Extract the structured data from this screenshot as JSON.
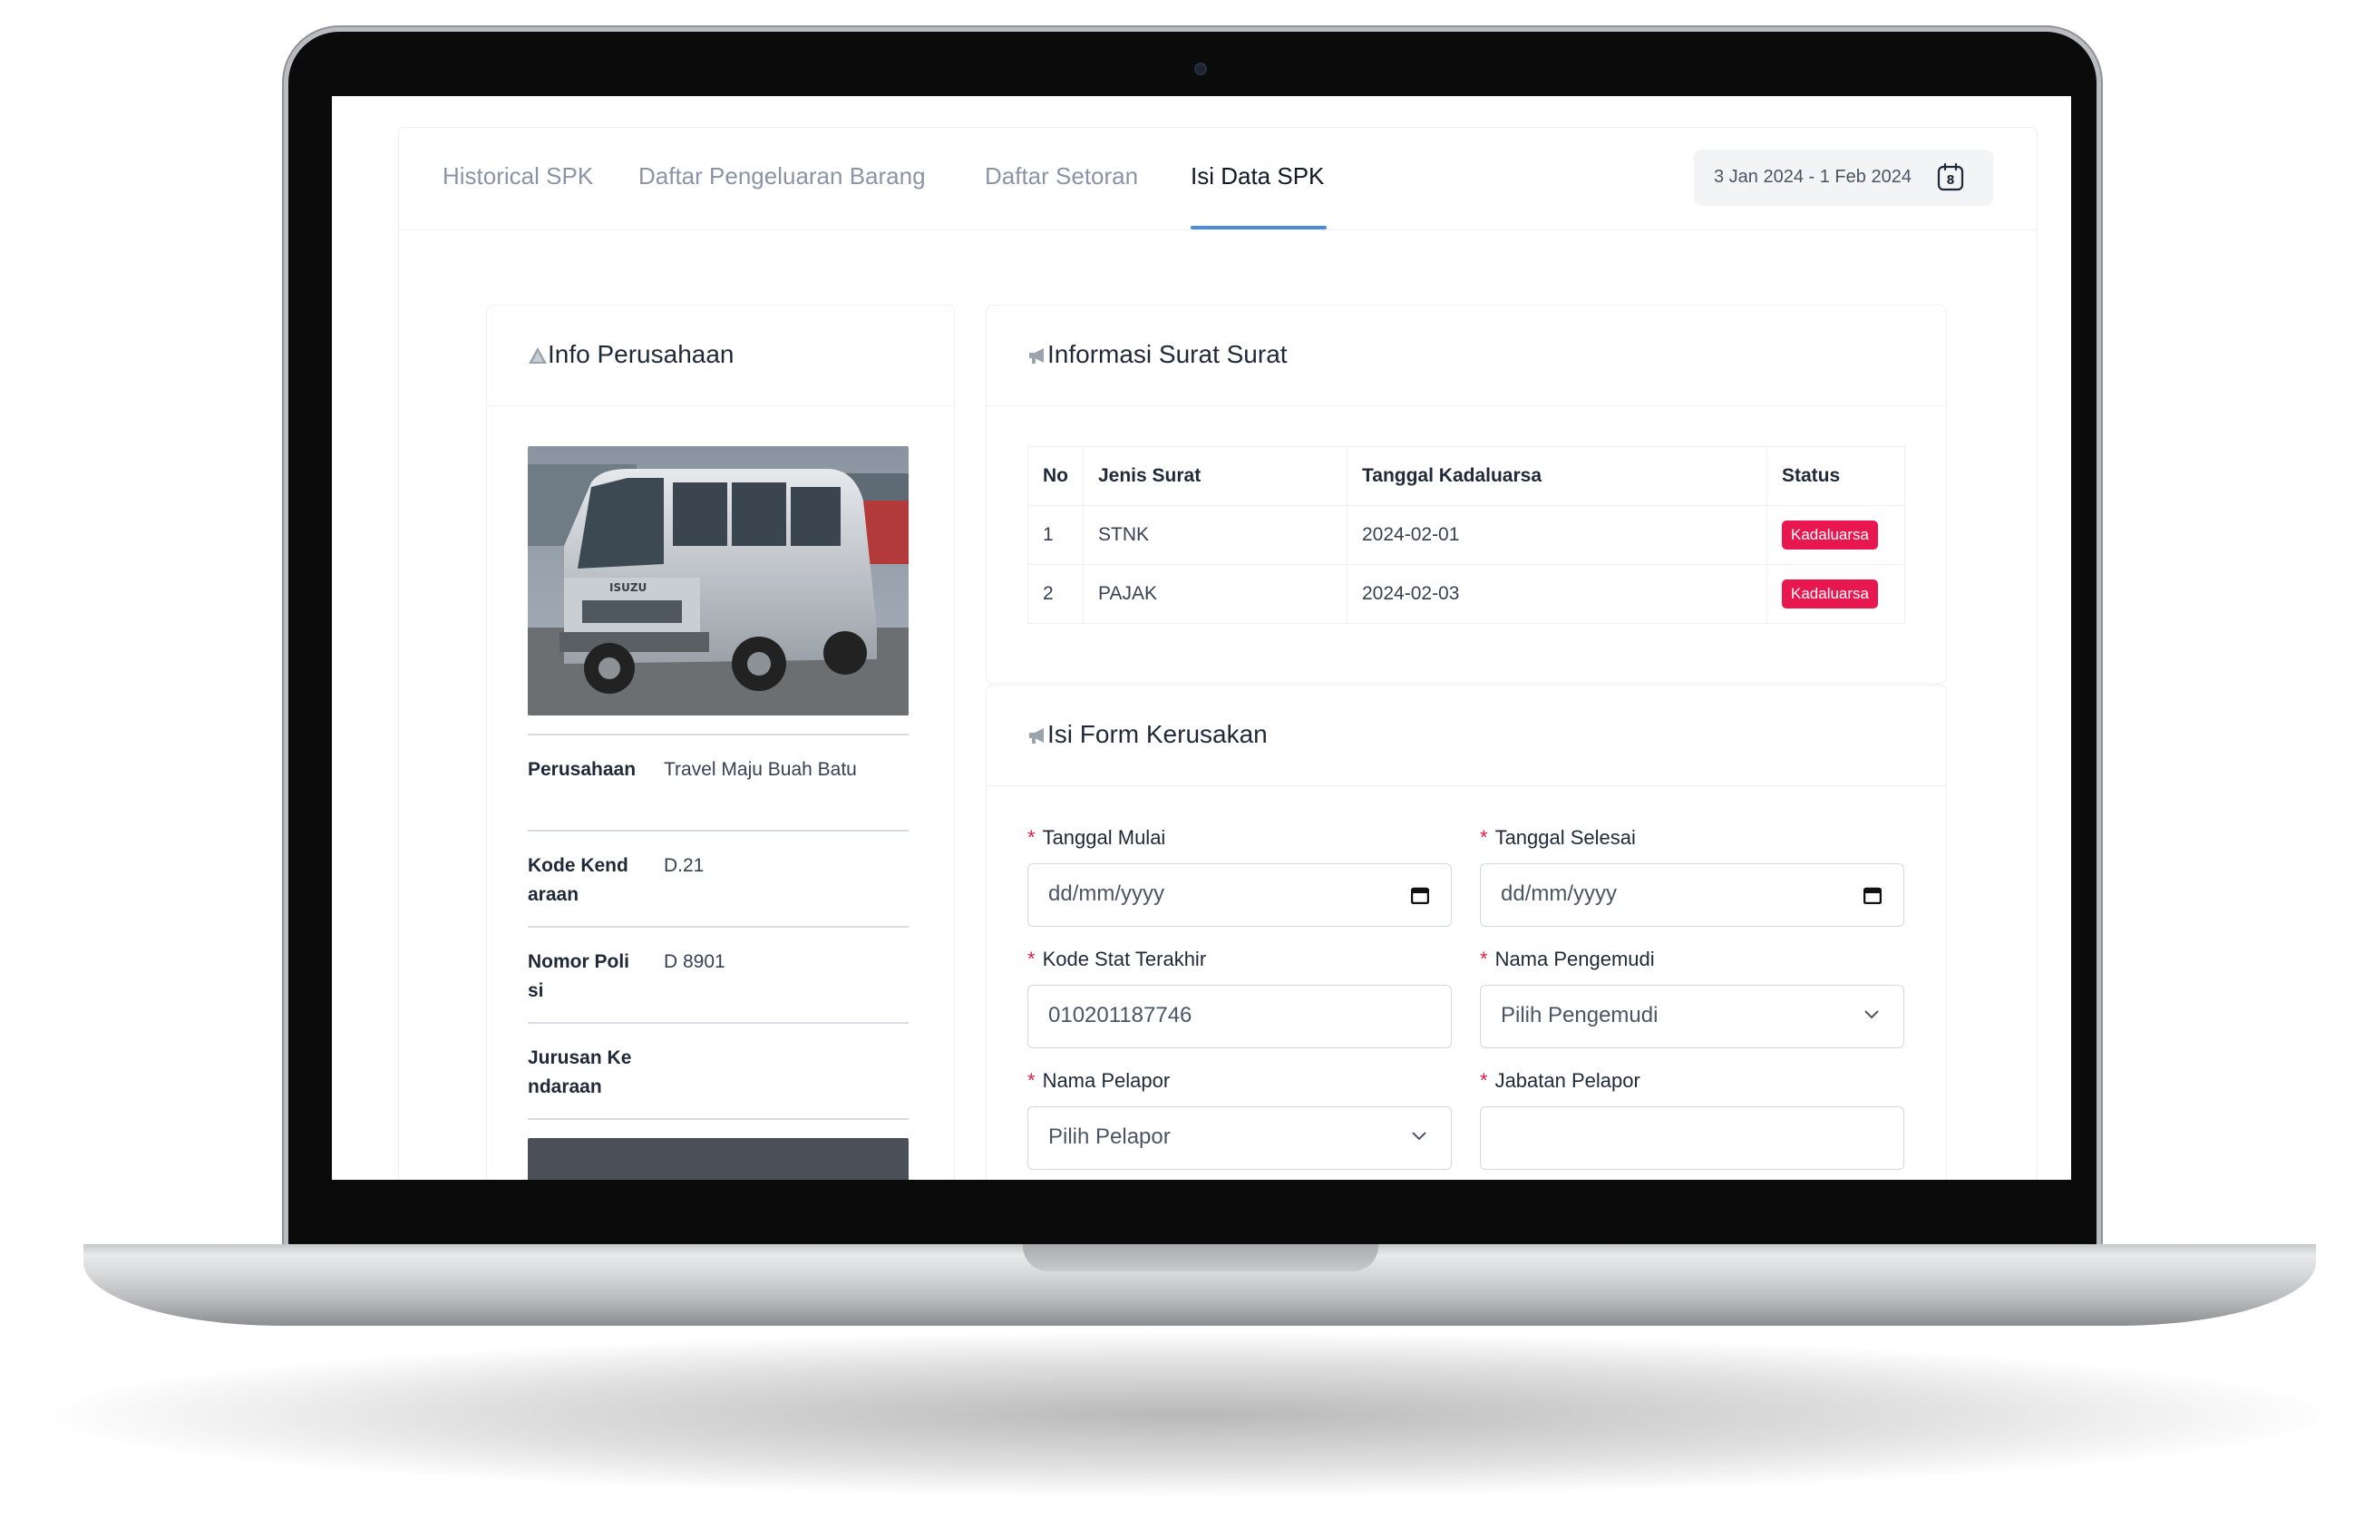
{
  "tabs": {
    "historical": "Historical SPK",
    "pengeluaran": "Daftar Pengeluaran Barang",
    "setoran": "Daftar Setoran",
    "isi_data": "Isi Data SPK",
    "active": "Isi Data SPK"
  },
  "date_range": "3 Jan 2024 - 1 Feb 2024",
  "calendar_day": "8",
  "info_perusahaan": {
    "title": "Info Perusahaan",
    "rows": [
      {
        "label": "Perusahaan",
        "value": "Travel Maju Buah Batu"
      },
      {
        "label": "Kode Kendaraan",
        "value": "D.21"
      },
      {
        "label": "Nomor Polisi",
        "value": "D 8901"
      },
      {
        "label": "Jurusan Kendaraan",
        "value": ""
      }
    ],
    "vehicle_brand": "ISUZU"
  },
  "informasi_surat": {
    "title": "Informasi Surat Surat",
    "headers": [
      "No",
      "Jenis Surat",
      "Tanggal Kadaluarsa",
      "Status"
    ],
    "rows": [
      {
        "no": "1",
        "jenis": "STNK",
        "tanggal": "2024-02-01",
        "status": "Kadaluarsa"
      },
      {
        "no": "2",
        "jenis": "PAJAK",
        "tanggal": "2024-02-03",
        "status": "Kadaluarsa"
      }
    ]
  },
  "form_kerusakan": {
    "title": "Isi Form Kerusakan",
    "required_mark": "*",
    "tanggal_mulai": {
      "label": "Tanggal Mulai",
      "value": "dd/mm/yyyy"
    },
    "tanggal_selesai": {
      "label": "Tanggal Selesai",
      "value": "dd/mm/yyyy"
    },
    "kode_stat": {
      "label": "Kode Stat Terakhir",
      "value": "010201187746"
    },
    "nama_pengemudi": {
      "label": "Nama Pengemudi",
      "value": "Pilih Pengemudi"
    },
    "nama_pelapor": {
      "label": "Nama Pelapor",
      "value": "Pilih Pelapor"
    },
    "jabatan_pelapor": {
      "label": "Jabatan Pelapor",
      "value": ""
    }
  },
  "colors": {
    "accent": "#4f8bd6",
    "badge": "#e8174f",
    "required": "#e11d48"
  }
}
